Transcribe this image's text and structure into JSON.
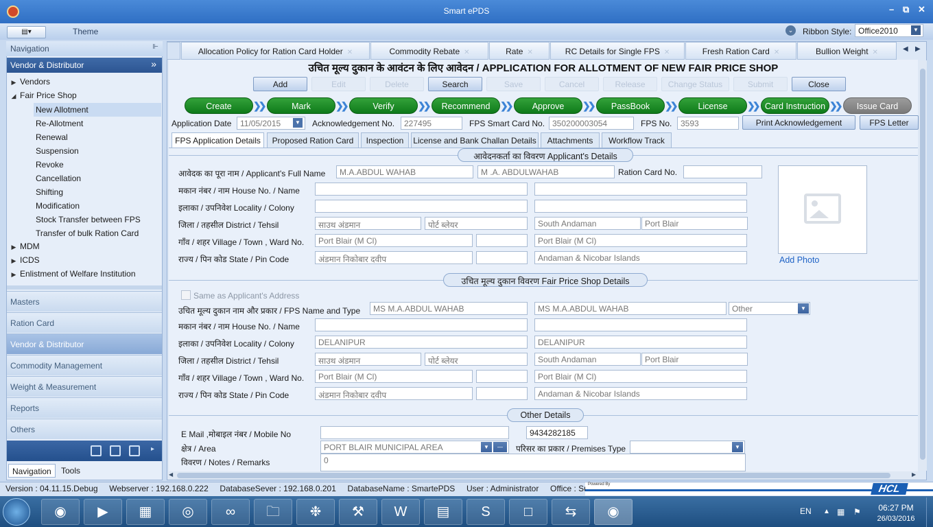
{
  "window": {
    "title": "Smart ePDS"
  },
  "ribbon": {
    "theme_label": "Theme",
    "style_label": "Ribbon Style:",
    "style_value": "Office2010"
  },
  "nav": {
    "header": "Navigation",
    "section": "Vendor & Distributor",
    "tree": [
      {
        "label": "Vendors",
        "arrow": "▶"
      },
      {
        "label": "Fair Price Shop",
        "arrow": "◢"
      }
    ],
    "fps_items": [
      "New Allotment",
      "Re-Allotment",
      "Renewal",
      "Suspension",
      "Revoke",
      "Cancellation",
      "Shifting",
      "Modification",
      "Stock Transfer between FPS",
      "Transfer of bulk Ration Card"
    ],
    "tree2": [
      {
        "label": "MDM",
        "arrow": "▶"
      },
      {
        "label": "ICDS",
        "arrow": "▶"
      },
      {
        "label": "Enlistment of Welfare Institution",
        "arrow": "▶"
      }
    ],
    "groups": [
      "Masters",
      "Ration Card",
      "Vendor & Distributor",
      "Commodity Management",
      "Weight & Measurement",
      "Reports",
      "Others"
    ],
    "bottom_tabs": [
      "Navigation",
      "Tools"
    ]
  },
  "page_tabs": [
    "Allocation Policy for Ration Card Holder",
    "Commodity Rebate",
    "Rate",
    "RC Details for Single FPS",
    "Fresh Ration Card",
    "Bullion Weight"
  ],
  "form": {
    "title": "उचित मूल्य दुकान के आवंटन के लिए आवेदन / APPLICATION FOR ALLOTMENT OF NEW FAIR PRICE SHOP",
    "buttons": [
      "Add",
      "Edit",
      "Delete",
      "Search",
      "Save",
      "Cancel",
      "Release",
      "Change Status",
      "Submit",
      "Close"
    ],
    "workflow": [
      "Create",
      "Mark",
      "Verify",
      "Recommend",
      "Approve",
      "PassBook",
      "License",
      "Card Instruction",
      "Issue Card"
    ],
    "app_date_label": "Application Date",
    "app_date": "11/05/2015",
    "ack_label": "Acknowledgement No.",
    "ack_no": "227495",
    "smart_card_label": "FPS Smart Card No.",
    "smart_card": "350200003054",
    "fps_no_label": "FPS  No.",
    "fps_no": "3593",
    "print_ack": "Print Acknowledgement",
    "fps_letter": "FPS Letter",
    "sub_tabs": [
      "FPS Application Details",
      "Proposed Ration Card",
      "Inspection",
      "License and Bank Challan Details",
      "Attachments",
      "Workflow Track"
    ],
    "applicant": {
      "header": "आवेदनकर्ता का विवरण Applicant's Details",
      "name_label": "आवेदक का पूरा नाम / Applicant's Full Name",
      "name_hi": "M.A.ABDUL WAHAB",
      "name_en": "M .A. ABDULWAHAB",
      "rc_label": "Ration Card No.",
      "rc_value": "",
      "house_label": "मकान नंबर / नाम  House No. / Name",
      "locality_label": "इलाका / उपनिवेश  Locality / Colony",
      "district_label": "जिला / तहसील  District / Tehsil",
      "district_hi": "साउथ अंडमान",
      "tehsil_hi": "पोर्ट ब्लेयर",
      "district_en": "South Andaman",
      "tehsil_en": "Port Blair",
      "village_label": "गाँव / शहर  Village / Town , Ward No.",
      "village_hi": "Port Blair (M Cl)",
      "village_en": "Port Blair (M Cl)",
      "state_label": "राज्य / पिन कोड  State / Pin Code",
      "state_hi": "अंडमान निकोबार दवीप",
      "state_en": "Andaman & Nicobar Islands",
      "add_photo": "Add Photo"
    },
    "fps": {
      "header": "उचित मूल्य दुकान विवरण Fair Price Shop Details",
      "same_as": "Same as Applicant's Address",
      "name_label": "उचित मूल्य दुकान नाम और प्रकार / FPS Name and Type",
      "name_hi": "MS M.A.ABDUL WAHAB",
      "name_en": "MS M.A.ABDUL WAHAB",
      "type": "Other",
      "house_label": "मकान नंबर / नाम  House No. / Name",
      "locality_label": "इलाका / उपनिवेश  Locality / Colony",
      "locality_hi": "DELANIPUR",
      "locality_en": "DELANIPUR",
      "district_label": "जिला / तहसील  District / Tehsil",
      "district_hi": "साउथ अंडमान",
      "tehsil_hi": "पोर्ट ब्लेयर",
      "district_en": "South Andaman",
      "tehsil_en": "Port Blair",
      "village_label": "गाँव / शहर  Village / Town , Ward No.",
      "village_hi": "Port Blair (M Cl)",
      "village_en": "Port Blair (M Cl)",
      "state_label": "राज्य / पिन कोड  State / Pin Code",
      "state_hi": "अंडमान निकोबार दवीप",
      "state_en": "Andaman & Nicobar Islands"
    },
    "other": {
      "header": "Other Details",
      "email_label": "E Mail ,मोबाइल नंबर / Mobile No",
      "email": "",
      "mobile": "9434282185",
      "area_label": "क्षेत्र / Area",
      "area": "PORT BLAIR MUNICIPAL AREA",
      "premises_label": "परिसर का प्रकार / Premises Type",
      "premises": "",
      "notes_label": "विवरण / Notes / Remarks",
      "notes": "0"
    }
  },
  "status_bar": "Version : 04.11.15.Debug     Webserver : 192.168.0.222     DatabaseSever : 192.168.0.201     DatabaseName : SmartePDS     User : Administrator     Office : Supply U",
  "brand": {
    "powered": "Powered By",
    "logo": "HCL"
  },
  "taskbar": {
    "lang": "EN",
    "time": "06:27 PM",
    "date": "26/03/2016"
  },
  "colors": {
    "accent": "#2c5592",
    "workflow_active": "#0e7a1a",
    "workflow_pending": "#7a7a7a"
  }
}
